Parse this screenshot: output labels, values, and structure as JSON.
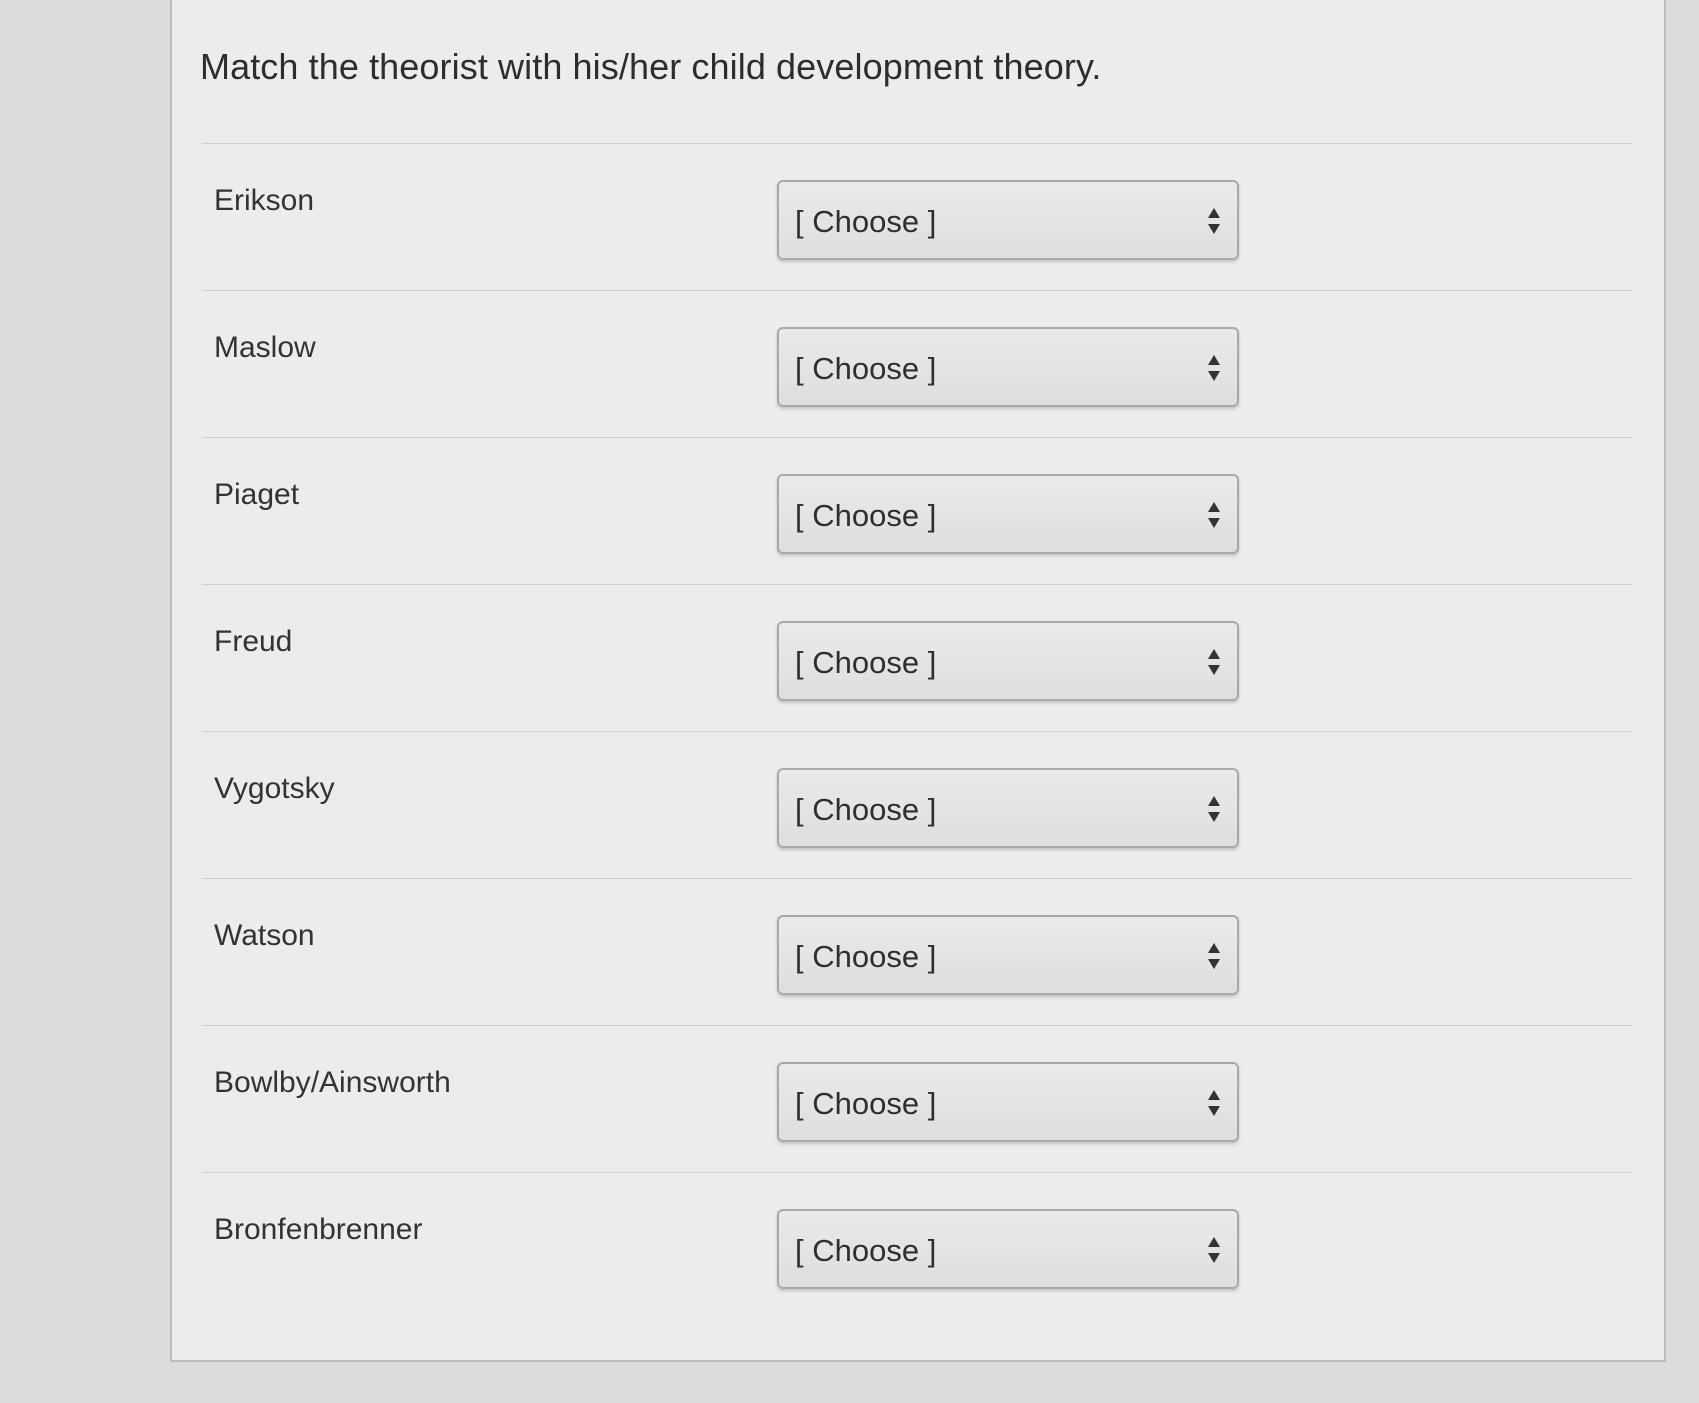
{
  "question": "Match the theorist with his/her child development theory.",
  "select_default": "[ Choose ]",
  "rows": [
    {
      "label": "Erikson",
      "value": "[ Choose ]"
    },
    {
      "label": "Maslow",
      "value": "[ Choose ]"
    },
    {
      "label": "Piaget",
      "value": "[ Choose ]"
    },
    {
      "label": "Freud",
      "value": "[ Choose ]"
    },
    {
      "label": "Vygotsky",
      "value": "[ Choose ]"
    },
    {
      "label": "Watson",
      "value": "[ Choose ]"
    },
    {
      "label": "Bowlby/Ainsworth",
      "value": "[ Choose ]"
    },
    {
      "label": "Bronfenbrenner",
      "value": "[ Choose ]"
    }
  ]
}
